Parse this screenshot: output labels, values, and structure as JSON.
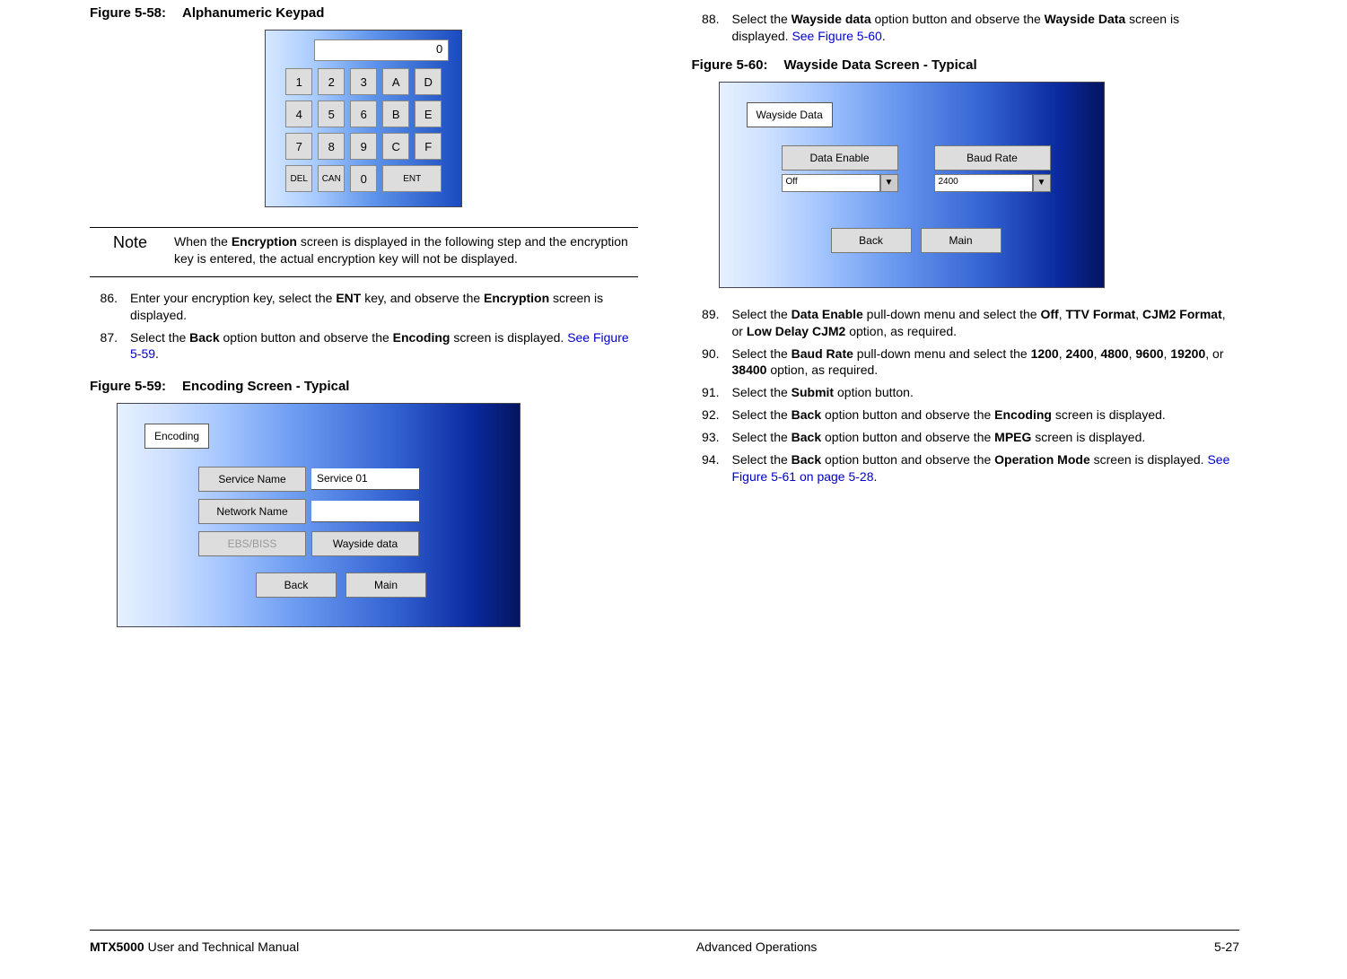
{
  "left": {
    "fig58": {
      "label": "Figure 5-58:",
      "title": "Alphanumeric Keypad"
    },
    "keypad": {
      "display": "0",
      "r1": [
        "1",
        "2",
        "3",
        "A",
        "D"
      ],
      "r2": [
        "4",
        "5",
        "6",
        "B",
        "E"
      ],
      "r3": [
        "7",
        "8",
        "9",
        "C",
        "F"
      ],
      "r4": {
        "del": "DEL",
        "can": "CAN",
        "zero": "0",
        "ent": "ENT"
      }
    },
    "note": {
      "label": "Note",
      "text_a": "When the ",
      "bold_a": "Encryption",
      "text_b": " screen is displayed in the following step and the encryption key is entered, the actual encryption key will not be displayed."
    },
    "step86": {
      "num": "86.",
      "t1": "Enter your encryption key, select the ",
      "b1": "ENT",
      "t2": " key, and observe the ",
      "b2": "Encryption",
      "t3": " screen is displayed."
    },
    "step87": {
      "num": "87.",
      "t1": "Select the ",
      "b1": "Back",
      "t2": " option button and observe the ",
      "b2": "Encoding",
      "t3": " screen is displayed.  ",
      "xref": "See Figure 5-59",
      "t4": "."
    },
    "fig59": {
      "label": "Figure 5-59:",
      "title": "Encoding Screen - Typical"
    },
    "encoding": {
      "tab": "Encoding",
      "service_name_label": "Service Name",
      "service_name_value": "Service 01",
      "network_name_label": "Network Name",
      "network_name_value": "",
      "ebs": "EBS/BISS",
      "wayside": "Wayside data",
      "back": "Back",
      "main": "Main"
    }
  },
  "right": {
    "step88": {
      "num": "88.",
      "t1": "Select the ",
      "b1": "Wayside data",
      "t2": " option button and observe the ",
      "b2": "Wayside Data",
      "t3": " screen is displayed.  ",
      "xref": "See Figure 5-60",
      "t4": "."
    },
    "fig60": {
      "label": "Figure 5-60:",
      "title": "Wayside Data Screen - Typical"
    },
    "wayside": {
      "tab": "Wayside Data",
      "data_enable_label": "Data Enable",
      "baud_rate_label": "Baud Rate",
      "data_enable_value": "Off",
      "baud_rate_value": "2400",
      "arrow": "▼",
      "back": "Back",
      "main": "Main"
    },
    "step89": {
      "num": "89.",
      "t1": "Select the ",
      "b1": "Data Enable",
      "t2": " pull-down menu and select the ",
      "b2": "Off",
      "t3": ", ",
      "b3": "TTV Format",
      "t4": ", ",
      "b4": "CJM2 Format",
      "t5": ", or ",
      "b5": "Low Delay CJM2",
      "t6": " option, as required."
    },
    "step90": {
      "num": "90.",
      "t1": "Select the ",
      "b1": "Baud Rate",
      "t2": " pull-down menu and select the ",
      "b2": "1200",
      "t3": ", ",
      "b3": "2400",
      "t4": ", ",
      "b4": "4800",
      "t5": ", ",
      "b5": "9600",
      "t6": ", ",
      "b6": "19200",
      "t7": ", or ",
      "b7": "38400",
      "t8": " option, as required."
    },
    "step91": {
      "num": "91.",
      "t1": "Select the ",
      "b1": "Submit",
      "t2": " option button."
    },
    "step92": {
      "num": "92.",
      "t1": "Select the ",
      "b1": "Back",
      "t2": " option button and observe the ",
      "b2": "Encoding",
      "t3": " screen is displayed."
    },
    "step93": {
      "num": "93.",
      "t1": "Select the ",
      "b1": "Back",
      "t2": " option button and observe the ",
      "b2": "MPEG",
      "t3": " screen is displayed."
    },
    "step94": {
      "num": "94.",
      "t1": "Select the ",
      "b1": "Back",
      "t2": " option button and observe the ",
      "b2": "Operation Mode",
      "t3": " screen is displayed.  ",
      "xref": "See Figure 5-61 on page 5-28",
      "t4": "."
    }
  },
  "footer": {
    "left_bold": "MTX5000",
    "left_rest": " User and Technical Manual",
    "center": "Advanced Operations",
    "right": "5-27"
  }
}
